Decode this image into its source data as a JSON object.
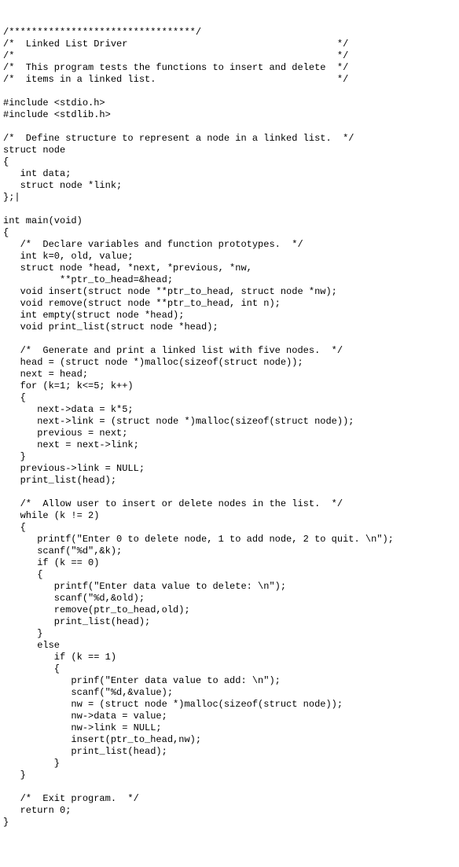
{
  "lines": [
    "/*********************************/",
    "/*  Linked List Driver                                     */",
    "/*                                                         */",
    "/*  This program tests the functions to insert and delete  */",
    "/*  items in a linked list.                                */",
    "",
    "#include <stdio.h>",
    "#include <stdlib.h>",
    "",
    "/*  Define structure to represent a node in a linked list.  */",
    "struct node",
    "{",
    "   int data;",
    "   struct node *link;",
    "};|",
    "",
    "int main(void)",
    "{",
    "   /*  Declare variables and function prototypes.  */",
    "   int k=0, old, value;",
    "   struct node *head, *next, *previous, *nw,",
    "          **ptr_to_head=&head;",
    "   void insert(struct node **ptr_to_head, struct node *nw);",
    "   void remove(struct node **ptr_to_head, int n);",
    "   int empty(struct node *head);",
    "   void print_list(struct node *head);",
    "",
    "   /*  Generate and print a linked list with five nodes.  */",
    "   head = (struct node *)malloc(sizeof(struct node));",
    "   next = head;",
    "   for (k=1; k<=5; k++)",
    "   {",
    "      next->data = k*5;",
    "      next->link = (struct node *)malloc(sizeof(struct node));",
    "      previous = next;",
    "      next = next->link;",
    "   }",
    "   previous->link = NULL;",
    "   print_list(head);",
    "",
    "   /*  Allow user to insert or delete nodes in the list.  */",
    "   while (k != 2)",
    "   {",
    "      printf(\"Enter 0 to delete node, 1 to add node, 2 to quit. \\n\");",
    "      scanf(\"%d\",&k);",
    "      if (k == 0)",
    "      {",
    "         printf(\"Enter data value to delete: \\n\");",
    "         scanf(\"%d,&old);",
    "         remove(ptr_to_head,old);",
    "         print_list(head);",
    "      }",
    "      else",
    "         if (k == 1)",
    "         {",
    "            prinf(\"Enter data value to add: \\n\");",
    "            scanf(\"%d,&value);",
    "            nw = (struct node *)malloc(sizeof(struct node));",
    "            nw->data = value;",
    "            nw->link = NULL;",
    "            insert(ptr_to_head,nw);",
    "            print_list(head);",
    "         }",
    "   }",
    "",
    "   /*  Exit program.  */",
    "   return 0;",
    "}"
  ]
}
